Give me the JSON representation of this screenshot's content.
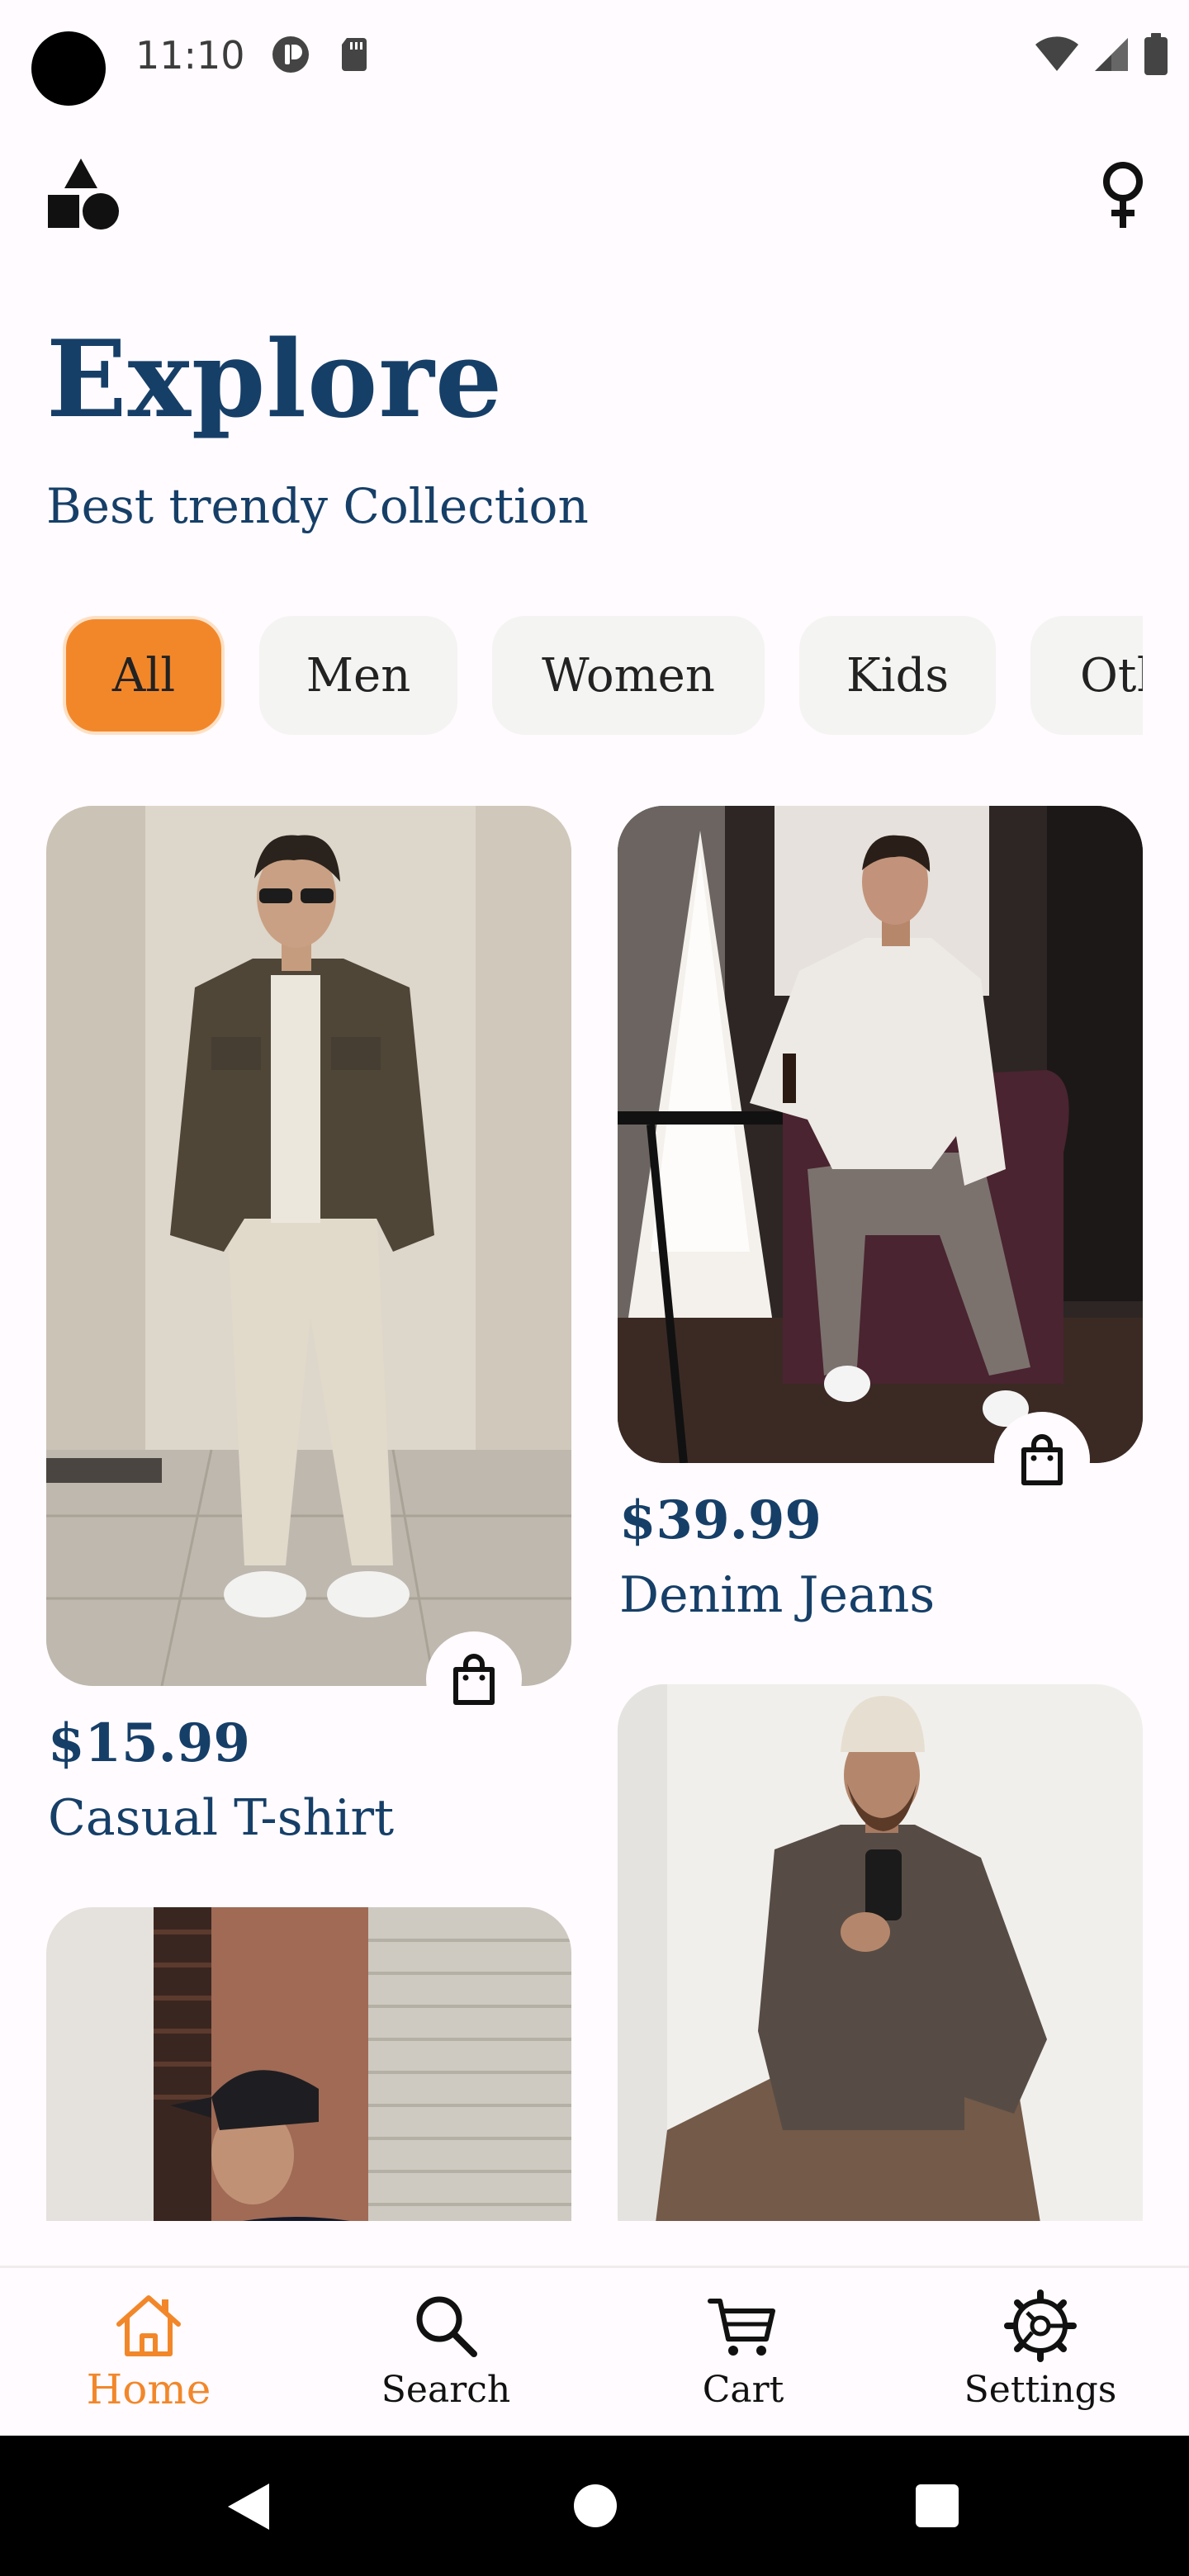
{
  "status_bar": {
    "time": "11:10"
  },
  "header": {
    "title": "Explore",
    "subtitle": "Best trendy Collection"
  },
  "categories": [
    {
      "label": "All",
      "selected": true
    },
    {
      "label": "Men",
      "selected": false
    },
    {
      "label": "Women",
      "selected": false
    },
    {
      "label": "Kids",
      "selected": false
    },
    {
      "label": "Other",
      "selected": false
    }
  ],
  "products": [
    {
      "price": "$15.99",
      "name": "Casual T-shirt"
    },
    {
      "price": "$39.99",
      "name": "Denim Jeans"
    }
  ],
  "bottom_nav": [
    {
      "label": "Home",
      "icon": "home-icon",
      "active": true
    },
    {
      "label": "Search",
      "icon": "search-icon",
      "active": false
    },
    {
      "label": "Cart",
      "icon": "cart-icon",
      "active": false
    },
    {
      "label": "Settings",
      "icon": "settings-icon",
      "active": false
    }
  ],
  "colors": {
    "accent": "#F2872A",
    "primary": "#163F68",
    "background": "#FFFBFE",
    "chip": "#F4F4F2"
  }
}
